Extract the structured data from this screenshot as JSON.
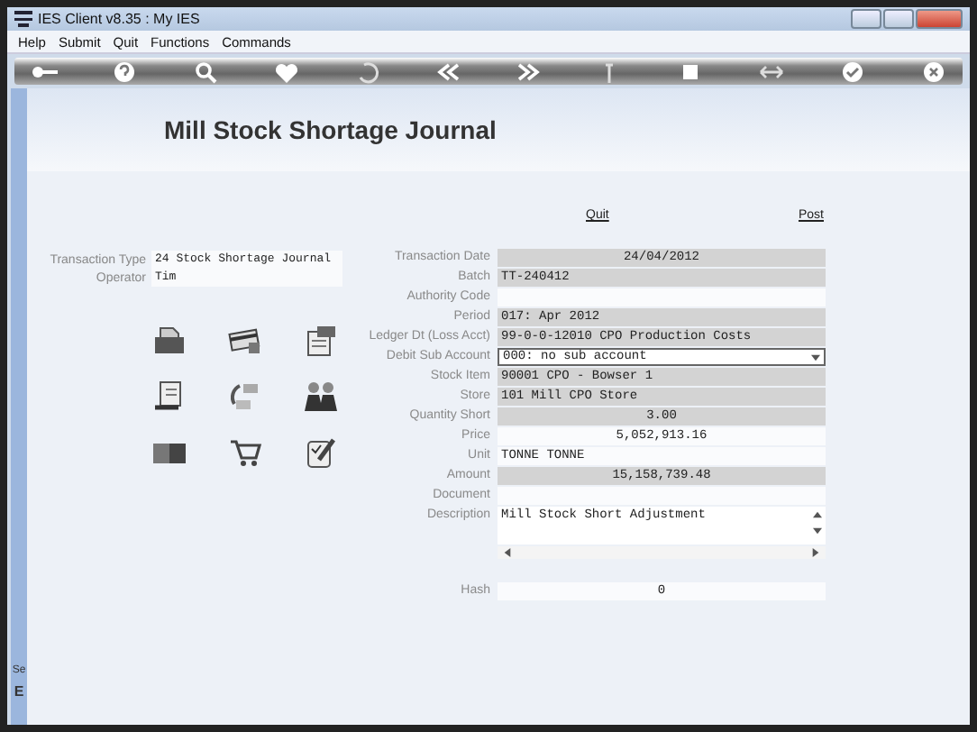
{
  "window": {
    "title": "IES Client v8.35 : My IES"
  },
  "menu": [
    "Help",
    "Submit",
    "Quit",
    "Functions",
    "Commands"
  ],
  "page_title": "Mill Stock Shortage Journal",
  "header_fields": [
    {
      "label": "Transaction Type",
      "value": "24 Stock Shortage Journal"
    },
    {
      "label": "Operator",
      "value": "Tim"
    }
  ],
  "links": [
    "Quit",
    "Post"
  ],
  "fields": [
    {
      "label": "Transaction Date",
      "value": "24/04/2012",
      "kind": "figure"
    },
    {
      "label": "Batch",
      "value": "TT-240412",
      "kind": "readonly"
    },
    {
      "label": "Authority Code",
      "kind": "input"
    },
    {
      "label": "Period",
      "value": "017: Apr 2012",
      "kind": "readonly"
    },
    {
      "label": "Ledger Dt (Loss Acct)",
      "value": "99-0-0-12010 CPO Production Costs",
      "kind": "readonly"
    },
    {
      "label": "Debit Sub Account",
      "value": "000: no sub account",
      "kind": "select"
    },
    {
      "label": "Stock Item",
      "value": "90001 CPO - Bowser 1",
      "kind": "readonly"
    },
    {
      "label": "Store",
      "value": "101 Mill CPO Store",
      "kind": "readonly"
    },
    {
      "label": "Quantity Short",
      "value": "3.00",
      "kind": "figure"
    },
    {
      "label": "Price",
      "value": "5,052,913.16",
      "kind": "number"
    },
    {
      "label": "Unit",
      "value": "TONNE TONNE",
      "kind": "input"
    },
    {
      "label": "Amount",
      "value": "15,158,739.48",
      "kind": "figure"
    },
    {
      "label": "Document",
      "kind": "input"
    },
    {
      "label": "Description",
      "value": "Mill Stock Short Adjustment",
      "kind": "textarea"
    },
    {
      "label": "Hash",
      "value": "0",
      "kind": "hash"
    }
  ],
  "sidebar": {
    "label": "Se",
    "key": "E"
  }
}
